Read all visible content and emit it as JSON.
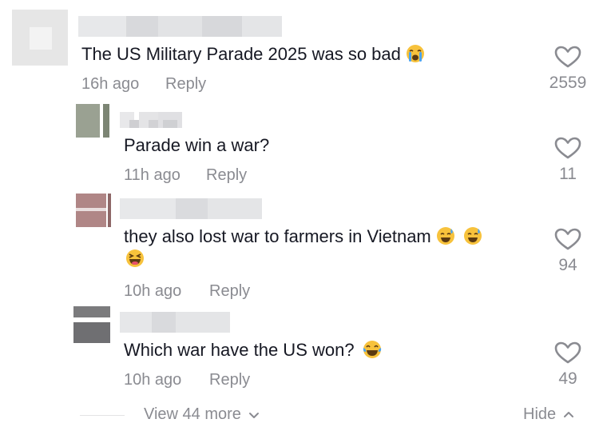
{
  "comments": [
    {
      "text": "The US Military Parade 2025 was so bad",
      "emojis": [
        "crying-face-emoji"
      ],
      "time": "16h ago",
      "reply_label": "Reply",
      "likes": "2559"
    },
    {
      "text": "Parade win a war?",
      "emojis": [],
      "time": "11h ago",
      "reply_label": "Reply",
      "likes": "11"
    },
    {
      "text": "they also lost war to farmers in Vietnam",
      "emojis": [
        "grinning-sweat-emoji",
        "grinning-sweat-emoji",
        "laughing-squint-emoji"
      ],
      "time": "10h ago",
      "reply_label": "Reply",
      "likes": "94"
    },
    {
      "text": "Which war have the US won?",
      "emojis": [
        "tears-of-joy-emoji"
      ],
      "time": "10h ago",
      "reply_label": "Reply",
      "likes": "49"
    }
  ],
  "footer": {
    "view_more_label": "View 44 more",
    "hide_label": "Hide"
  },
  "colors": {
    "text": "#161823",
    "muted": "#8a8b91",
    "emoji_yellow": "#f7c23c"
  }
}
